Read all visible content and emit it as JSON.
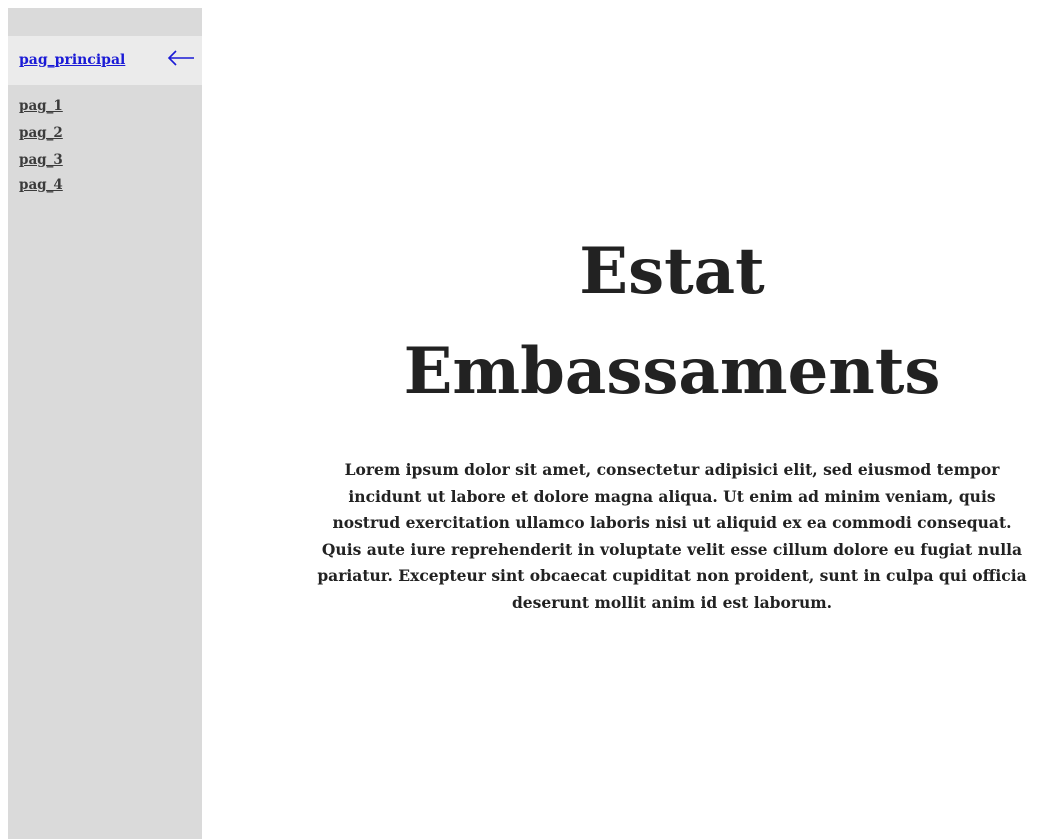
{
  "sidebar": {
    "active_item": {
      "label": "pag_principal"
    },
    "active_indicator_icon": "left-arrow-icon",
    "items": [
      {
        "label": "pag_1"
      },
      {
        "label": "pag_2"
      },
      {
        "label": "pag_3"
      },
      {
        "label": "pag_4"
      }
    ]
  },
  "main": {
    "title_line1": "Estat",
    "title_line2": "Embassaments",
    "paragraph": "Lorem ipsum dolor sit amet, consectetur adipisici elit, sed eiusmod tempor incidunt ut labore et dolore magna aliqua. Ut enim ad minim veniam, quis nostrud exercitation ullamco laboris nisi ut aliquid ex ea commodi consequat. Quis aute iure reprehenderit in voluptate velit esse cillum dolore eu fugiat nulla pariatur. Excepteur sint obcaecat cupiditat non proident, sunt in culpa qui officia deserunt mollit anim id est laborum."
  },
  "colors": {
    "sidebar_bg": "#dadada",
    "active_bg": "#ebebeb",
    "link_active": "#1a1ad6",
    "text": "#222222"
  }
}
